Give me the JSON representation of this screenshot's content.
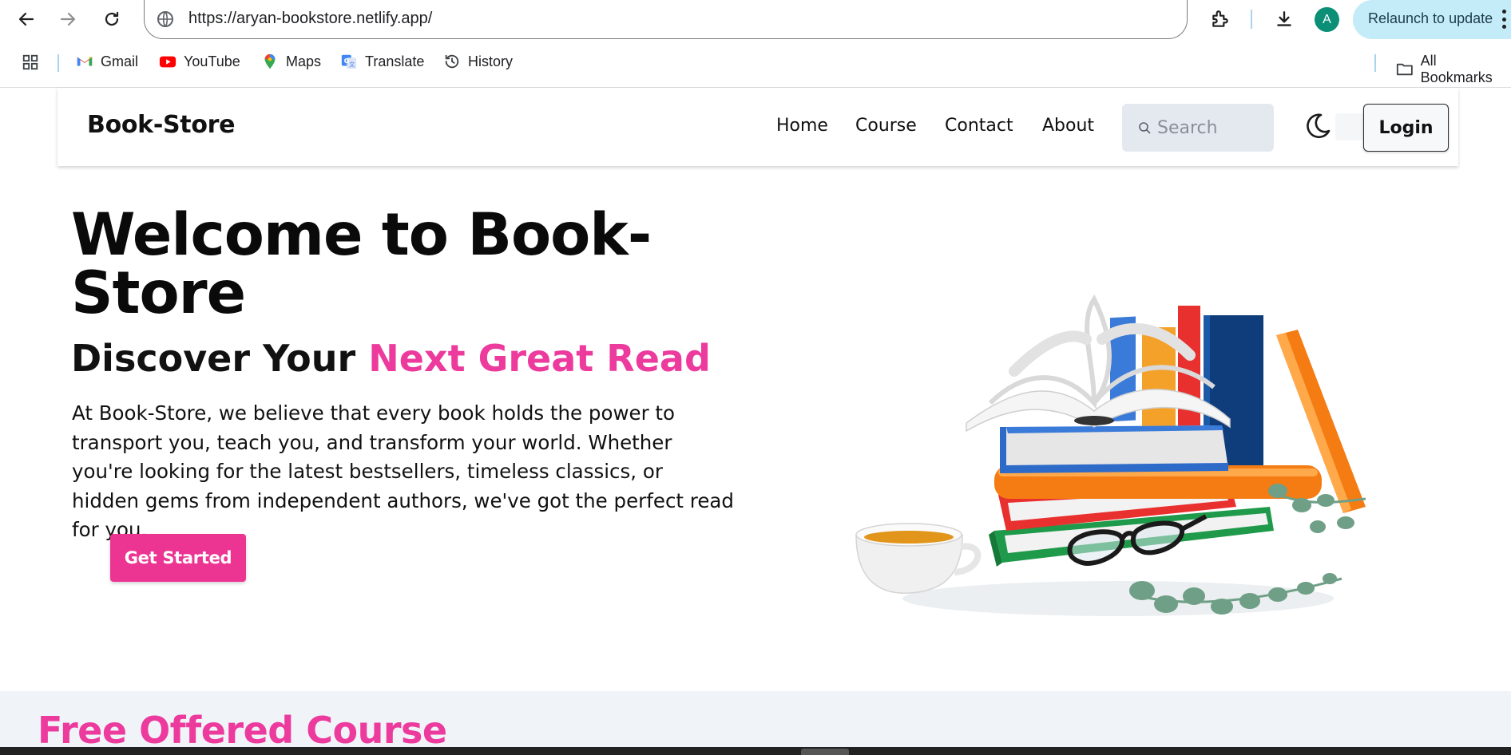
{
  "browser": {
    "url": "https://aryan-bookstore.netlify.app/",
    "avatar_initial": "A",
    "relaunch_label": "Relaunch to update",
    "bookmarks": [
      {
        "label": "Gmail",
        "icon": "gmail-icon"
      },
      {
        "label": "YouTube",
        "icon": "youtube-icon"
      },
      {
        "label": "Maps",
        "icon": "maps-icon"
      },
      {
        "label": "Translate",
        "icon": "translate-icon"
      },
      {
        "label": "History",
        "icon": "history-icon"
      }
    ],
    "all_bookmarks_label": "All Bookmarks"
  },
  "site": {
    "brand": "Book-Store",
    "nav": [
      "Home",
      "Course",
      "Contact",
      "About"
    ],
    "search_placeholder": "Search",
    "login_label": "Login",
    "theme_icon": "moon-icon"
  },
  "hero": {
    "title": "Welcome to Book-Store",
    "subtitle_plain": "Discover Your ",
    "subtitle_accent": "Next Great Read",
    "body": "At Book-Store, we believe that every book holds the power to transport you, teach you, and transform your world. Whether you're looking for the latest bestsellers, timeless classics, or hidden gems from independent authors, we've got the perfect read for you.",
    "cta_label": "Get Started"
  },
  "courses": {
    "title": "Free Offered Course"
  },
  "colors": {
    "accent": "#ec3a9d",
    "cta": "#ec3593",
    "section_bg": "#f0f4f9"
  }
}
